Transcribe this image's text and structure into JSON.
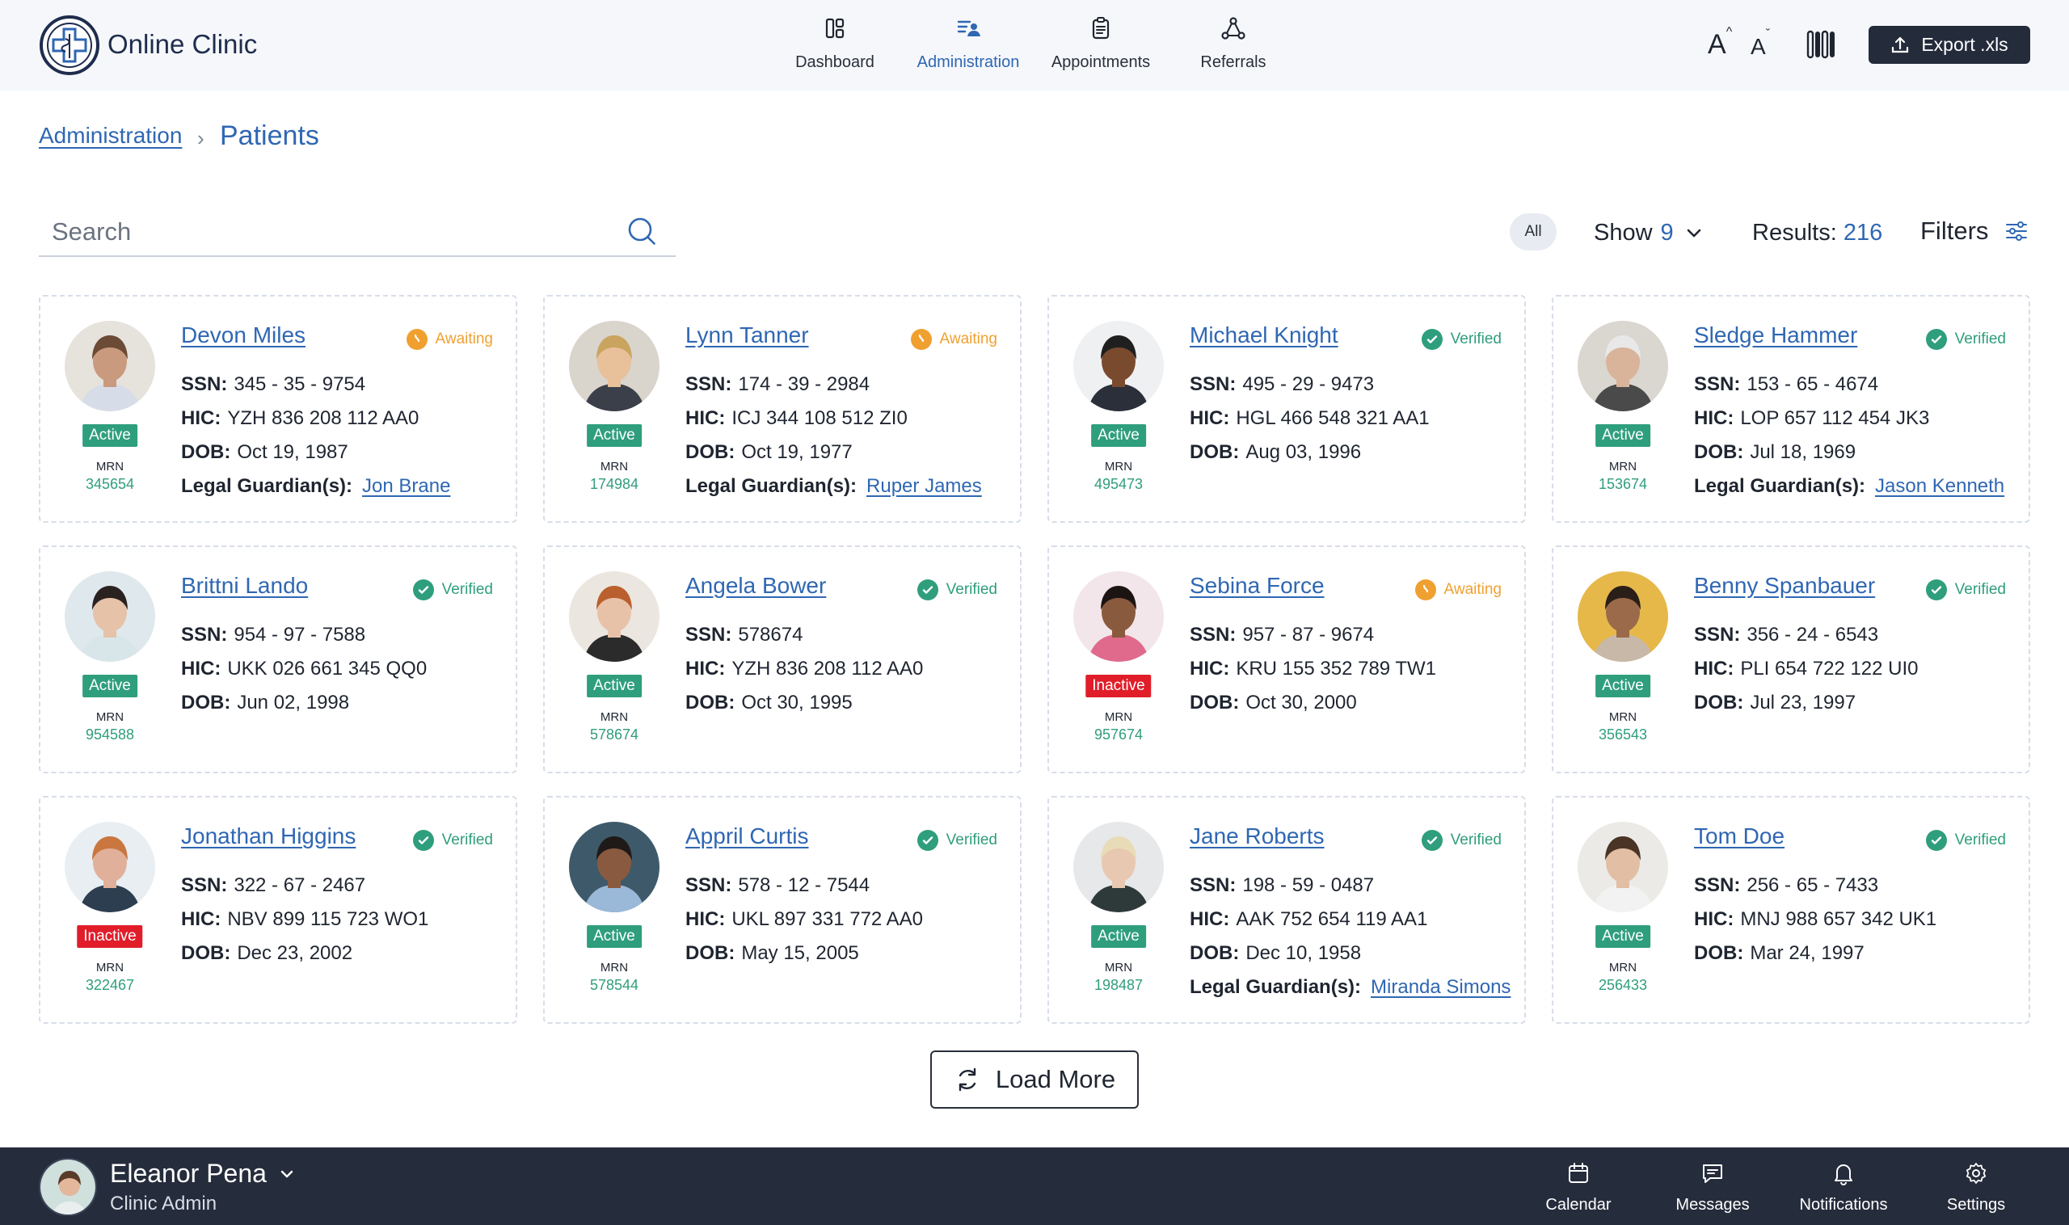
{
  "app": {
    "title": "Online Clinic"
  },
  "nav": [
    {
      "label": "Dashboard",
      "icon": "dashboard-icon"
    },
    {
      "label": "Administration",
      "icon": "administration-icon",
      "active": true
    },
    {
      "label": "Appointments",
      "icon": "clipboard-icon"
    },
    {
      "label": "Referrals",
      "icon": "network-icon"
    }
  ],
  "toolbar": {
    "font_increase": "A",
    "font_decrease": "A",
    "export_label": "Export .xls"
  },
  "breadcrumb": {
    "parent": "Administration",
    "separator": "›",
    "current": "Patients"
  },
  "search": {
    "placeholder": "Search"
  },
  "filters": {
    "all_label": "All",
    "show_label": "Show",
    "show_value": "9",
    "results_label": "Results:",
    "results_value": "216",
    "filters_label": "Filters"
  },
  "labels": {
    "ssn": "SSN:",
    "hic": "HIC:",
    "dob": "DOB:",
    "guardian": "Legal Guardian(s):",
    "mrn": "MRN"
  },
  "patients": [
    {
      "name": "Devon Miles",
      "verification": "Awaiting",
      "status": "Active",
      "mrn": "345654",
      "ssn": "345 - 35 - 9754",
      "hic": "YZH 836 208 112 AA0",
      "dob": "Oct 19, 1987",
      "guardian": "Jon Brane"
    },
    {
      "name": "Lynn Tanner",
      "verification": "Awaiting",
      "status": "Active",
      "mrn": "174984",
      "ssn": "174 - 39 - 2984",
      "hic": "ICJ 344 108 512 ZI0",
      "dob": "Oct 19, 1977",
      "guardian": "Ruper James"
    },
    {
      "name": "Michael Knight",
      "verification": "Verified",
      "status": "Active",
      "mrn": "495473",
      "ssn": "495 - 29 - 9473",
      "hic": "HGL 466 548 321 AA1",
      "dob": "Aug 03, 1996",
      "guardian": ""
    },
    {
      "name": "Sledge Hammer",
      "verification": "Verified",
      "status": "Active",
      "mrn": "153674",
      "ssn": "153 - 65 - 4674",
      "hic": "LOP 657 112 454 JK3",
      "dob": "Jul 18, 1969",
      "guardian": "Jason Kenneth"
    },
    {
      "name": "Brittni Lando",
      "verification": "Verified",
      "status": "Active",
      "mrn": "954588",
      "ssn": "954 - 97 - 7588",
      "hic": "UKK 026 661 345 QQ0",
      "dob": "Jun 02, 1998",
      "guardian": ""
    },
    {
      "name": "Angela Bower",
      "verification": "Verified",
      "status": "Active",
      "mrn": "578674",
      "ssn": "578674",
      "hic": "YZH 836 208 112 AA0",
      "dob": "Oct 30, 1995",
      "guardian": ""
    },
    {
      "name": "Sebina Force",
      "verification": "Awaiting",
      "status": "Inactive",
      "mrn": "957674",
      "ssn": "957 - 87 - 9674",
      "hic": "KRU 155 352 789 TW1",
      "dob": "Oct 30, 2000",
      "guardian": ""
    },
    {
      "name": "Benny Spanbauer",
      "verification": "Verified",
      "status": "Active",
      "mrn": "356543",
      "ssn": "356 - 24 - 6543",
      "hic": "PLI 654 722 122 UI0",
      "dob": "Jul 23, 1997",
      "guardian": ""
    },
    {
      "name": "Jonathan Higgins",
      "verification": "Verified",
      "status": "Inactive",
      "mrn": "322467",
      "ssn": "322 - 67 - 2467",
      "hic": "NBV 899 115 723 WO1",
      "dob": "Dec 23, 2002",
      "guardian": ""
    },
    {
      "name": "Appril Curtis",
      "verification": "Verified",
      "status": "Active",
      "mrn": "578544",
      "ssn": "578 - 12 - 7544",
      "hic": "UKL 897 331 772 AA0",
      "dob": "May 15, 2005",
      "guardian": ""
    },
    {
      "name": "Jane Roberts",
      "verification": "Verified",
      "status": "Active",
      "mrn": "198487",
      "ssn": "198 - 59 - 0487",
      "hic": "AAK 752 654 119 AA1",
      "dob": "Dec 10, 1958",
      "guardian": "Miranda Simons"
    },
    {
      "name": "Tom Doe",
      "verification": "Verified",
      "status": "Active",
      "mrn": "256433",
      "ssn": "256 - 65 - 7433",
      "hic": "MNJ 988 657 342 UK1",
      "dob": "Mar 24, 1997",
      "guardian": ""
    }
  ],
  "load_more": {
    "label": "Load More"
  },
  "user": {
    "name": "Eleanor Pena",
    "role": "Clinic Admin"
  },
  "bottom_nav": [
    {
      "label": "Calendar",
      "icon": "calendar-icon"
    },
    {
      "label": "Messages",
      "icon": "messages-icon"
    },
    {
      "label": "Notifications",
      "icon": "bell-icon"
    },
    {
      "label": "Settings",
      "icon": "gear-icon"
    }
  ],
  "colors": {
    "brand": "#2f67b3",
    "verified": "#2f9e7c",
    "awaiting": "#f0a030",
    "inactive": "#e11d2a",
    "dark": "#252c3b"
  }
}
